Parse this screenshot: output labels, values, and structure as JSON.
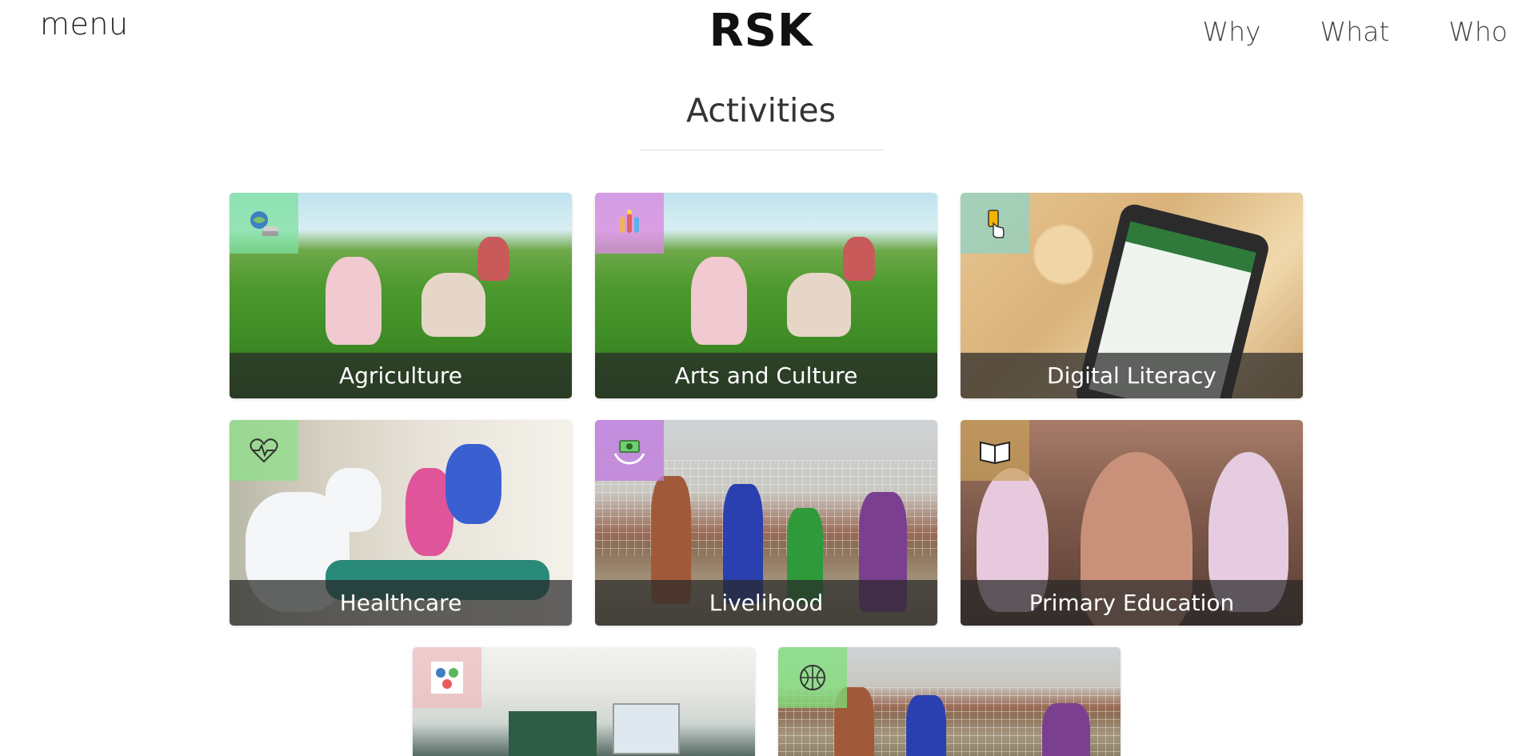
{
  "header": {
    "menu_label": "menu",
    "brand": "RSK",
    "nav": [
      "Why",
      "What",
      "Who"
    ]
  },
  "section": {
    "title": "Activities"
  },
  "cards": [
    {
      "label": "Agriculture",
      "icon": "globe-books-icon",
      "badge_color": "#7ee0a0"
    },
    {
      "label": "Arts and Culture",
      "icon": "hands-painting-icon",
      "badge_color": "#d98be0"
    },
    {
      "label": "Digital Literacy",
      "icon": "hand-phone-icon",
      "badge_color": "#8fd3c4"
    },
    {
      "label": "Healthcare",
      "icon": "heart-pulse-icon",
      "badge_color": "#8fe08a"
    },
    {
      "label": "Livelihood",
      "icon": "hands-money-icon",
      "badge_color": "#c17de0"
    },
    {
      "label": "Primary Education",
      "icon": "open-book-icon",
      "badge_color": "#c9a15a"
    },
    {
      "label": "",
      "icon": "people-circle-icon",
      "badge_color": "#f0b2b8"
    },
    {
      "label": "",
      "icon": "basketball-icon",
      "badge_color": "#7ee07a"
    }
  ]
}
